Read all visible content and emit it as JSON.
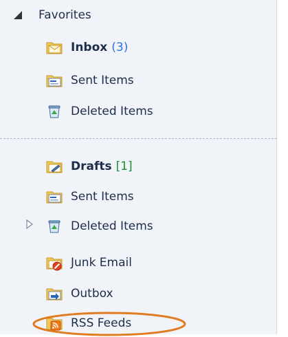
{
  "favorites": {
    "header": "Favorites",
    "items": [
      {
        "label": "Inbox",
        "count": "(3)",
        "icon": "inbox-folder-icon"
      },
      {
        "label": "Sent Items",
        "icon": "sent-items-icon"
      },
      {
        "label": "Deleted Items",
        "icon": "deleted-items-icon"
      }
    ]
  },
  "mailbox": {
    "items": [
      {
        "label": "Drafts",
        "count": "[1]",
        "icon": "drafts-folder-icon"
      },
      {
        "label": "Sent Items",
        "icon": "sent-items-icon"
      },
      {
        "label": "Deleted Items",
        "icon": "deleted-items-icon"
      },
      {
        "label": "Junk Email",
        "icon": "junk-email-icon"
      },
      {
        "label": "Outbox",
        "icon": "outbox-icon"
      },
      {
        "label": "RSS Feeds",
        "icon": "rss-feeds-icon"
      }
    ]
  },
  "colors": {
    "pane_background": "#f0f3f8",
    "unread_count": "#2f6fe6",
    "draft_count": "#1f8a35",
    "highlight_ellipse": "#e07b1f"
  }
}
